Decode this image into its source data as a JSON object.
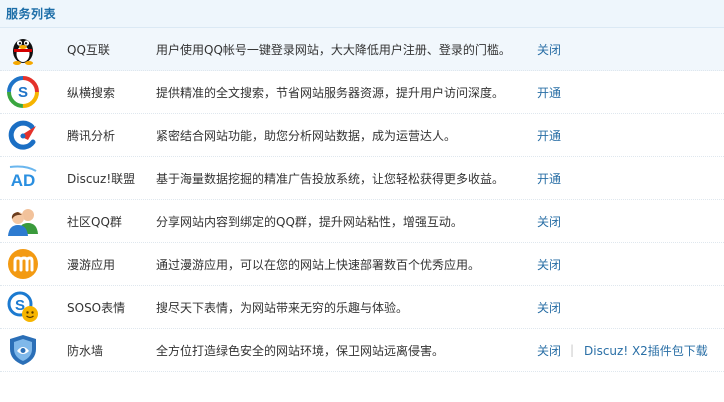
{
  "header": {
    "title": "服务列表"
  },
  "services": [
    {
      "icon": "qq-penguin-icon",
      "name": "QQ互联",
      "desc": "用户使用QQ帐号一键登录网站，大大降低用户注册、登录的门槛。",
      "action": "关闭"
    },
    {
      "icon": "zongheng-search-icon",
      "name": "纵横搜索",
      "desc": "提供精准的全文搜索，节省网站服务器资源，提升用户访问深度。",
      "action": "开通"
    },
    {
      "icon": "tencent-analytics-icon",
      "name": "腾讯分析",
      "desc": "紧密结合网站功能，助您分析网站数据，成为运营达人。",
      "action": "开通"
    },
    {
      "icon": "ad-alliance-icon",
      "name": "Discuz!联盟",
      "desc": "基于海量数据挖掘的精准广告投放系统，让您轻松获得更多收益。",
      "action": "开通"
    },
    {
      "icon": "qq-group-icon",
      "name": "社区QQ群",
      "desc": "分享网站内容到绑定的QQ群，提升网站粘性，增强互动。",
      "action": "关闭"
    },
    {
      "icon": "manyou-app-icon",
      "name": "漫游应用",
      "desc": "通过漫游应用，可以在您的网站上快速部署数百个优秀应用。",
      "action": "关闭"
    },
    {
      "icon": "soso-emoticon-icon",
      "name": "SOSO表情",
      "desc": "搜尽天下表情，为网站带来无穷的乐趣与体验。",
      "action": "关闭"
    },
    {
      "icon": "firewall-shield-icon",
      "name": "防水墙",
      "desc": "全方位打造绿色安全的网站环境，保卫网站远离侵害。",
      "action": "关闭",
      "separator": "|",
      "extra_link": "Discuz! X2插件包下载"
    }
  ],
  "colors": {
    "link": "#2a6fa6",
    "header_bg": "#eef6fc",
    "header_text": "#1d6ea8"
  }
}
